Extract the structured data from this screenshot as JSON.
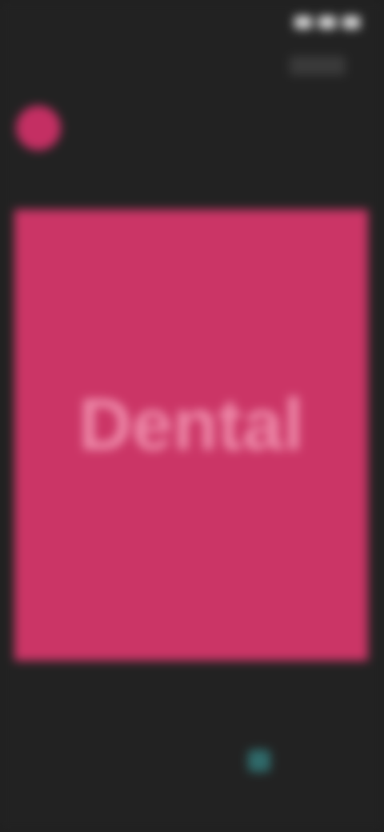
{
  "status_bar": {
    "time": ""
  },
  "header": {
    "name": ""
  },
  "post": {
    "title": "Dental",
    "subtitle": "",
    "color": "#cb3566"
  },
  "bottom_bar": {
    "items": [
      {
        "label": "",
        "icon": "home-icon"
      },
      {
        "label": "",
        "icon": "search-icon"
      },
      {
        "label": "",
        "icon": "add-icon"
      },
      {
        "label": "",
        "icon": "share-icon"
      },
      {
        "label": "",
        "icon": "more-icon"
      }
    ]
  }
}
